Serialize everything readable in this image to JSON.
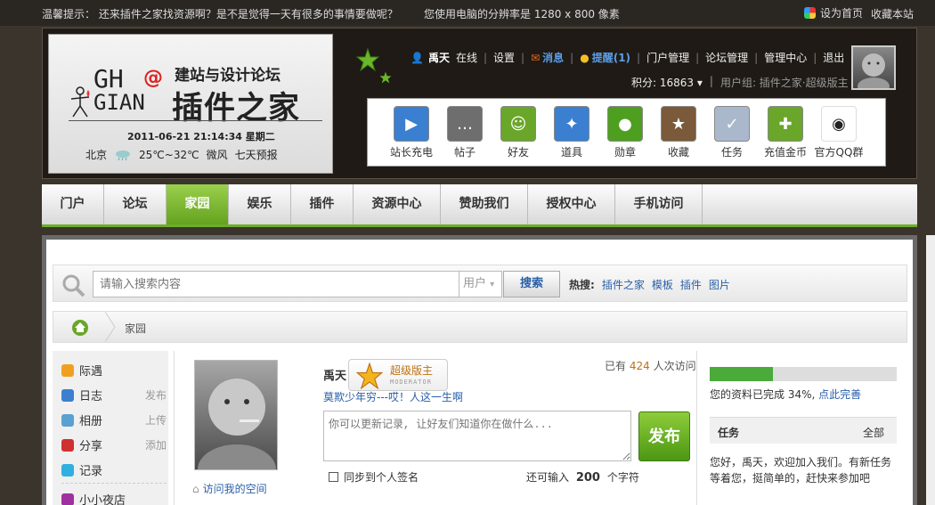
{
  "topbar": {
    "tip": "温馨提示： 还来插件之家找资源啊？是不是觉得一天有很多的事情要做呢？",
    "resolution": "您使用电脑的分辨率是 1280 x 800 像素",
    "set_home": "设为首页",
    "favorite": "收藏本站"
  },
  "logo": {
    "subtitle": "建站与设计论坛",
    "main": "插件之家",
    "gh": "GH",
    "at": "@",
    "gian": "GIAN",
    "datetime": "2011-06-21 21:14:34 星期二",
    "city": "北京",
    "temp": "25℃~32℃",
    "wind": "微风",
    "forecast": "七天预报"
  },
  "user": {
    "name": "禹天",
    "online": "在线",
    "settings": "设置",
    "messages": "消息",
    "reminders": "提醒(1)",
    "portal_manage": "门户管理",
    "forum_manage": "论坛管理",
    "admin_center": "管理中心",
    "logout": "退出",
    "score_label": "积分: 16863",
    "group": "用户组: 插件之家·超级版主"
  },
  "tools": [
    {
      "label": "站长充电",
      "icon": "media-icon",
      "color": "#3a7fd0"
    },
    {
      "label": "帖子",
      "icon": "chat-icon",
      "color": "#6e6e6e"
    },
    {
      "label": "好友",
      "icon": "friends-icon",
      "color": "#6aa62a"
    },
    {
      "label": "道具",
      "icon": "wand-icon",
      "color": "#3a7fd0"
    },
    {
      "label": "勋章",
      "icon": "medal-icon",
      "color": "#4e9f20"
    },
    {
      "label": "收藏",
      "icon": "star-icon",
      "color": "#7a5a3a"
    },
    {
      "label": "任务",
      "icon": "task-icon",
      "color": "#aab8cc"
    },
    {
      "label": "充值金币",
      "icon": "coins-icon",
      "color": "#6aa62a"
    },
    {
      "label": "官方QQ群",
      "icon": "qq-icon",
      "color": "#ffffff"
    }
  ],
  "nav": [
    "门户",
    "论坛",
    "家园",
    "娱乐",
    "插件",
    "资源中心",
    "赞助我们",
    "授权中心",
    "手机访问"
  ],
  "nav_active": "家园",
  "search": {
    "placeholder": "请输入搜索内容",
    "scope": "用户",
    "button": "搜索",
    "hot_label": "热搜:",
    "hot": [
      "插件之家",
      "模板",
      "插件",
      "图片"
    ]
  },
  "breadcrumb": "家园",
  "leftnav": [
    {
      "label": "际遇",
      "action": "",
      "color": "#f0a020"
    },
    {
      "label": "日志",
      "action": "发布",
      "color": "#3a7fd0"
    },
    {
      "label": "相册",
      "action": "上传",
      "color": "#5aa0d0"
    },
    {
      "label": "分享",
      "action": "添加",
      "color": "#d03030"
    },
    {
      "label": "记录",
      "action": "",
      "color": "#30b0e0"
    },
    {
      "label": "小小夜店",
      "action": "",
      "color": "#a030a0"
    }
  ],
  "profile": {
    "name": "禹天",
    "badge_title": "超级版主",
    "badge_sub": "MODERATOR",
    "motto": "莫欺少年穷---哎！人这一生啊",
    "visits_prefix": "已有",
    "visits": "424",
    "visits_suffix": "人次访问",
    "status_placeholder": "你可以更新记录, 让好友们知道你在做什么...",
    "publish": "发布",
    "sync": "同步到个人签名",
    "remain_prefix": "还可输入",
    "remain": "200",
    "remain_suffix": "个字符",
    "visit_space": "访问我的空间"
  },
  "completion": {
    "percent": 34,
    "text": "您的资料已完成 34%, ",
    "link": "点此完善"
  },
  "task": {
    "title": "任务",
    "all": "全部",
    "text": "您好，禹天，欢迎加入我们。有新任务等着您，挺简单的，赶快来参加吧"
  }
}
